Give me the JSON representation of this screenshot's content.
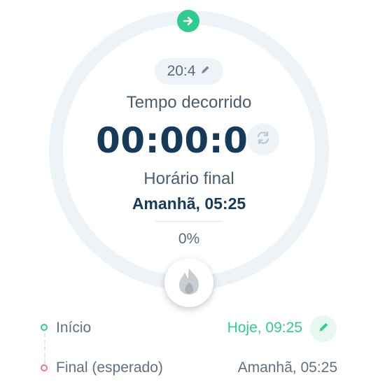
{
  "protocol": {
    "label": "20:4"
  },
  "elapsed": {
    "label": "Tempo decorrido",
    "value": "00:00:06"
  },
  "end_time": {
    "label": "Horário final",
    "value": "Amanhã, 05:25"
  },
  "progress": {
    "percent_label": "0%",
    "fraction": 0
  },
  "timeline": {
    "start": {
      "label": "Início",
      "value": "Hoje, 09:25"
    },
    "end": {
      "label": "Final (esperado)",
      "value": "Amanhã, 05:25"
    }
  },
  "colors": {
    "accent_green": "#2ecc8f",
    "end_red": "#f07a72",
    "ring_track": "#eef3f8",
    "text_dark": "#163a5a",
    "text_muted": "#5a6b7b"
  },
  "icons": {
    "top": "arrow-right-icon",
    "protocol_edit": "pencil-icon",
    "reset": "refresh-icon",
    "fast": "flame-icon",
    "edit_start": "pencil-icon"
  }
}
